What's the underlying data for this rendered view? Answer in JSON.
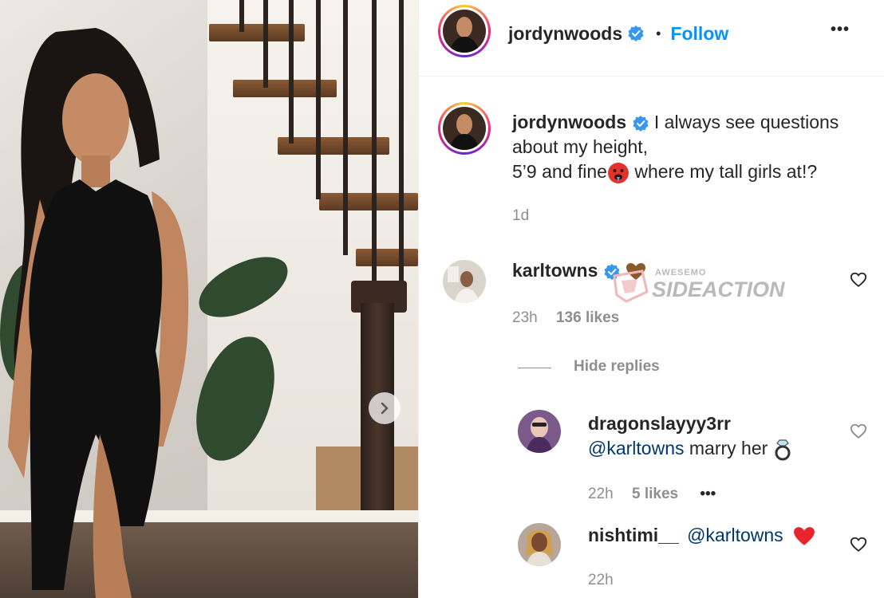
{
  "post": {
    "username": "jordynwoods",
    "follow_label": "Follow",
    "separator": "•",
    "more_label": "•••"
  },
  "caption": {
    "username": "jordynwoods",
    "line1": "I always see questions",
    "line2": "about my height,",
    "line3_a": "5’9 and fine",
    "line3_b": " where my tall girls at!?",
    "time": "1d"
  },
  "comments": [
    {
      "username": "karltowns",
      "text": "",
      "time": "23h",
      "likes": "136 likes"
    }
  ],
  "hide_replies_label": "Hide replies",
  "replies": [
    {
      "username": "dragonslayyy3rr",
      "mention": "@karltowns",
      "text": " marry her ",
      "time": "22h",
      "likes": "5 likes",
      "more": "•••"
    },
    {
      "username": "nishtimi__",
      "mention": "@karltowns",
      "text": "",
      "time": "22h"
    }
  ],
  "watermark": {
    "line1": "AWESEMO",
    "line2": "SIDEACTION"
  },
  "colors": {
    "accent": "#0095f6",
    "muted": "#8e8e8e",
    "text": "#262626",
    "mention": "#00376b"
  },
  "icons": [
    "verified-badge-icon",
    "heart-outline-icon",
    "next-arrow-icon",
    "red-heart-emoji",
    "brown-heart-emoji",
    "ring-emoji",
    "hot-face-emoji"
  ]
}
